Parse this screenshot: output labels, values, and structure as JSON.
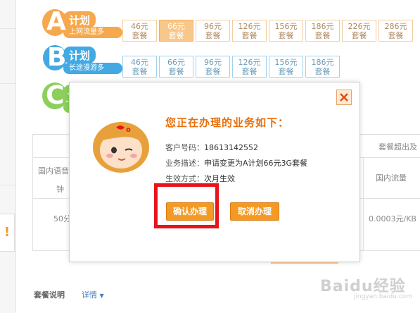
{
  "plans": [
    {
      "letter": "A",
      "word": "计划",
      "slogan": "上网流量多",
      "packages": [
        {
          "price": "46元",
          "unit": "套餐",
          "selected": false
        },
        {
          "price": "66元",
          "unit": "套餐",
          "selected": true
        },
        {
          "price": "96元",
          "unit": "套餐",
          "selected": false
        },
        {
          "price": "126元",
          "unit": "套餐",
          "selected": false
        },
        {
          "price": "156元",
          "unit": "套餐",
          "selected": false
        },
        {
          "price": "186元",
          "unit": "套餐",
          "selected": false
        },
        {
          "price": "226元",
          "unit": "套餐",
          "selected": false
        },
        {
          "price": "286元",
          "unit": "套餐",
          "selected": false
        }
      ]
    },
    {
      "letter": "B",
      "word": "计划",
      "slogan": "长途漫游多",
      "packages": [
        {
          "price": "46元",
          "unit": "套餐"
        },
        {
          "price": "66元",
          "unit": "套餐"
        },
        {
          "price": "96元",
          "unit": "套餐"
        },
        {
          "price": "126元",
          "unit": "套餐"
        },
        {
          "price": "156元",
          "unit": "套餐"
        },
        {
          "price": "186元",
          "unit": "套餐"
        }
      ]
    },
    {
      "letter": "C",
      "word": "计"
    }
  ],
  "table": {
    "header_right": "套餐超出及",
    "col1_line1": "国内语音",
    "col1_line2": "钟",
    "col_right": "国内流量",
    "row_left": "50分",
    "row_right": "0.0003元/KB"
  },
  "warning_mark": "!",
  "dialog": {
    "title": "您正在办理的业务如下：",
    "customer_label": "客户号码：",
    "customer_value": "18613142552",
    "desc_label": "业务描述：",
    "desc_value": "申请变更为A计划66元3G套餐",
    "effect_label": "生效方式：",
    "effect_value": "次月生效",
    "confirm_label": "确认办理",
    "cancel_label": "取消办理",
    "close_symbol": "×"
  },
  "footer": {
    "label": "套餐说明",
    "link": "详情",
    "caret": "▼"
  },
  "watermark": {
    "text": "Baidu经验",
    "sub": "jingyan.baidu.com"
  },
  "colors": {
    "accent_orange": "#f39a26",
    "title_orange": "#e86f0c",
    "highlight_red": "#e8141a",
    "plan_a": "#f6a84c",
    "plan_b": "#43a9e3",
    "plan_c": "#8ccf5a"
  }
}
